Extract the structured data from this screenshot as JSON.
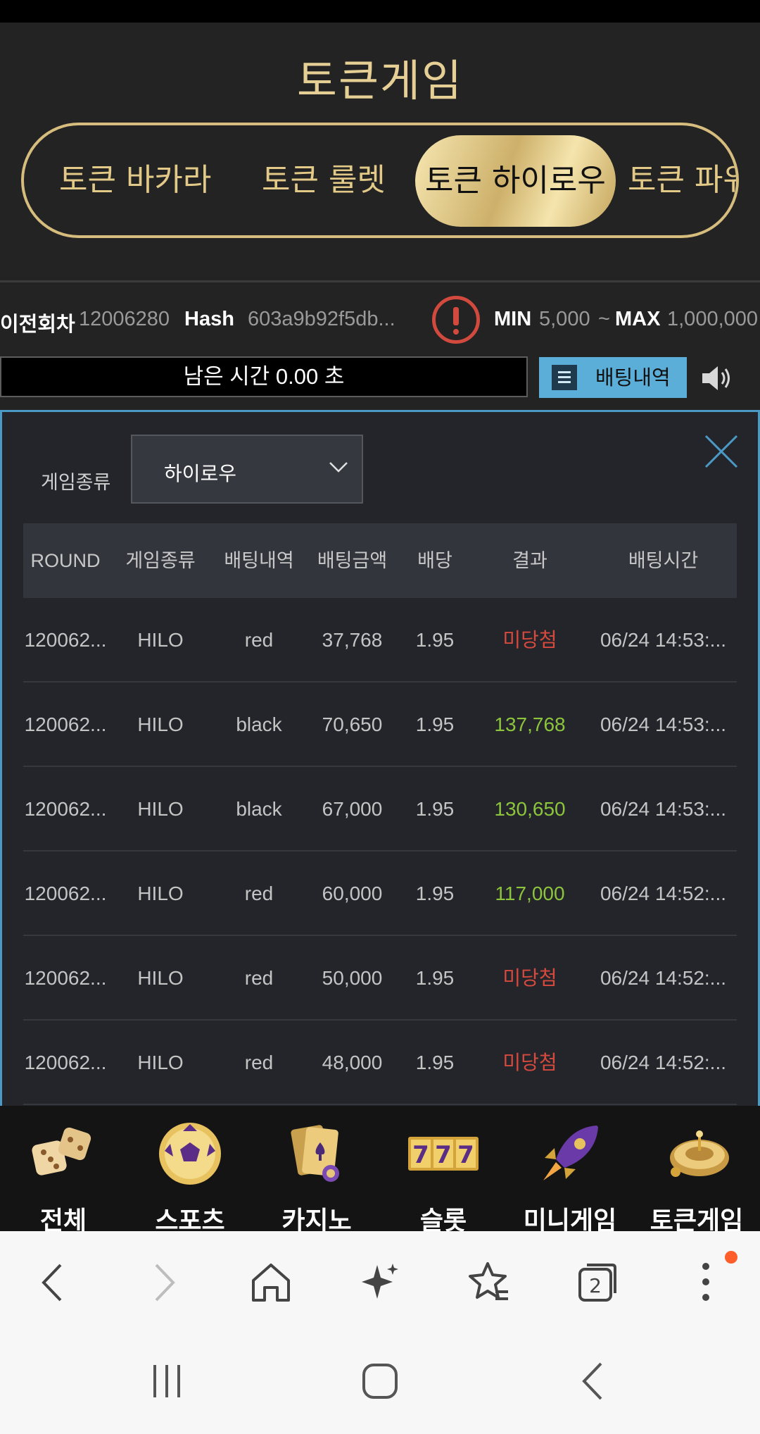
{
  "header": {
    "title": "토큰게임"
  },
  "tabs": [
    {
      "label": "토큰 바카라"
    },
    {
      "label": "토큰 룰렛"
    },
    {
      "label": "토큰 하이로우"
    },
    {
      "label": "토큰 파워"
    }
  ],
  "round_info": {
    "prev_round_label": "이전회차",
    "prev_round_value": "12006280",
    "hash_label": "Hash",
    "hash_value": "603a9b92f5db...",
    "min_label": "MIN",
    "min_value": "5,000",
    "tilde": "~",
    "max_label": "MAX",
    "max_value": "1,000,000"
  },
  "timer": {
    "text": "남은 시간 0.00 초"
  },
  "history_button": {
    "label": "배팅내역"
  },
  "panel": {
    "filter_label": "게임종류",
    "filter_selected": "하이로우",
    "columns": [
      "ROUND",
      "게임종류",
      "배팅내역",
      "배팅금액",
      "배당",
      "결과",
      "배팅시간"
    ],
    "rows": [
      {
        "round": "120062...",
        "game": "HILO",
        "bet": "red",
        "amount": "37,768",
        "odds": "1.95",
        "result": "미당첨",
        "result_type": "lose",
        "time": "06/24 14:53:..."
      },
      {
        "round": "120062...",
        "game": "HILO",
        "bet": "black",
        "amount": "70,650",
        "odds": "1.95",
        "result": "137,768",
        "result_type": "win",
        "time": "06/24 14:53:..."
      },
      {
        "round": "120062...",
        "game": "HILO",
        "bet": "black",
        "amount": "67,000",
        "odds": "1.95",
        "result": "130,650",
        "result_type": "win",
        "time": "06/24 14:53:..."
      },
      {
        "round": "120062...",
        "game": "HILO",
        "bet": "red",
        "amount": "60,000",
        "odds": "1.95",
        "result": "117,000",
        "result_type": "win",
        "time": "06/24 14:52:..."
      },
      {
        "round": "120062...",
        "game": "HILO",
        "bet": "red",
        "amount": "50,000",
        "odds": "1.95",
        "result": "미당첨",
        "result_type": "lose",
        "time": "06/24 14:52:..."
      },
      {
        "round": "120062...",
        "game": "HILO",
        "bet": "red",
        "amount": "48,000",
        "odds": "1.95",
        "result": "미당첨",
        "result_type": "lose",
        "time": "06/24 14:52:..."
      }
    ]
  },
  "bottom_nav": [
    {
      "label": "전체",
      "icon": "dice-icon"
    },
    {
      "label": "스포츠",
      "icon": "soccer-ball-icon"
    },
    {
      "label": "카지노",
      "icon": "playing-cards-icon"
    },
    {
      "label": "슬롯",
      "icon": "slot-777-icon"
    },
    {
      "label": "미니게임",
      "icon": "rocket-icon"
    },
    {
      "label": "토큰게임",
      "icon": "roulette-wheel-icon"
    }
  ],
  "browser": {
    "tabs_count": "2",
    "icons": [
      "back-icon",
      "forward-icon",
      "home-icon",
      "sparkle-icon",
      "bookmarks-icon",
      "tabs-icon",
      "more-icon"
    ]
  },
  "colors": {
    "gold": "#e2c987",
    "win": "#8cc43c",
    "lose": "#d64a3e",
    "accent_blue": "#5aaed8"
  }
}
